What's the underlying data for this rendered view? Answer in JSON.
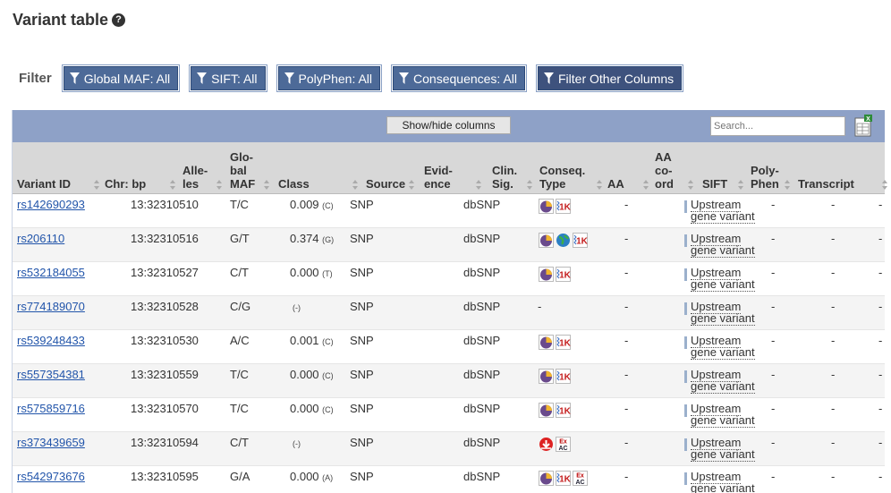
{
  "page": {
    "title": "Variant table"
  },
  "filter": {
    "label": "Filter",
    "buttons": [
      "Global MAF: All",
      "SIFT: All",
      "PolyPhen: All",
      "Consequences: All",
      "Filter Other Columns"
    ]
  },
  "toolbar": {
    "show_hide_label": "Show/hide columns",
    "search_placeholder": "Search..."
  },
  "columns": [
    [
      "Variant ID"
    ],
    [
      "Chr: bp"
    ],
    [
      "Alle-",
      "les"
    ],
    [
      "Glo-",
      "bal",
      "MAF"
    ],
    [
      "Class"
    ],
    [
      "Source"
    ],
    [
      "Evid-",
      "ence"
    ],
    [
      "Clin.",
      "Sig."
    ],
    [
      "Conseq.",
      "Type"
    ],
    [
      "AA"
    ],
    [
      "AA",
      "co-",
      "ord"
    ],
    [
      "SIFT"
    ],
    [
      "Poly-",
      "Phen"
    ],
    [
      "Transcript"
    ]
  ],
  "rows": [
    {
      "id": "rs142690293",
      "pos": "13:32310510",
      "alleles": "T/C",
      "maf": "0.009",
      "maf_allele": "(C)",
      "class": "SNP",
      "source": "dbSNP",
      "clin": "",
      "icons": [
        "pie",
        "1k"
      ],
      "aa": "-",
      "conseq": "Upstream gene variant",
      "sift": "-",
      "polyphen": "-",
      "transcript": "-"
    },
    {
      "id": "rs206110",
      "pos": "13:32310516",
      "alleles": "G/T",
      "maf": "0.374",
      "maf_allele": "(G)",
      "class": "SNP",
      "source": "dbSNP",
      "clin": "",
      "icons": [
        "pie",
        "globe",
        "1k"
      ],
      "aa": "-",
      "conseq": "Upstream gene variant",
      "sift": "-",
      "polyphen": "-",
      "transcript": "-"
    },
    {
      "id": "rs532184055",
      "pos": "13:32310527",
      "alleles": "C/T",
      "maf": "0.000",
      "maf_allele": "(T)",
      "class": "SNP",
      "source": "dbSNP",
      "clin": "",
      "icons": [
        "pie",
        "1k"
      ],
      "aa": "-",
      "conseq": "Upstream gene variant",
      "sift": "-",
      "polyphen": "-",
      "transcript": "-"
    },
    {
      "id": "rs774189070",
      "pos": "13:32310528",
      "alleles": "C/G",
      "maf": "",
      "maf_allele": "(-)",
      "class": "SNP",
      "source": "dbSNP",
      "clin": "-",
      "icons": [],
      "aa": "-",
      "conseq": "Upstream gene variant",
      "sift": "-",
      "polyphen": "-",
      "transcript": "-"
    },
    {
      "id": "rs539248433",
      "pos": "13:32310530",
      "alleles": "A/C",
      "maf": "0.001",
      "maf_allele": "(C)",
      "class": "SNP",
      "source": "dbSNP",
      "clin": "",
      "icons": [
        "pie",
        "1k"
      ],
      "aa": "-",
      "conseq": "Upstream gene variant",
      "sift": "-",
      "polyphen": "-",
      "transcript": "-"
    },
    {
      "id": "rs557354381",
      "pos": "13:32310559",
      "alleles": "T/C",
      "maf": "0.000",
      "maf_allele": "(C)",
      "class": "SNP",
      "source": "dbSNP",
      "clin": "",
      "icons": [
        "pie",
        "1k"
      ],
      "aa": "-",
      "conseq": "Upstream gene variant",
      "sift": "-",
      "polyphen": "-",
      "transcript": "-"
    },
    {
      "id": "rs575859716",
      "pos": "13:32310570",
      "alleles": "T/C",
      "maf": "0.000",
      "maf_allele": "(C)",
      "class": "SNP",
      "source": "dbSNP",
      "clin": "",
      "icons": [
        "pie",
        "1k"
      ],
      "aa": "-",
      "conseq": "Upstream gene variant",
      "sift": "-",
      "polyphen": "-",
      "transcript": "-"
    },
    {
      "id": "rs373439659",
      "pos": "13:32310594",
      "alleles": "C/T",
      "maf": "",
      "maf_allele": "(-)",
      "class": "SNP",
      "source": "dbSNP",
      "clin": "",
      "icons": [
        "arrow",
        "exac"
      ],
      "aa": "-",
      "conseq": "Upstream gene variant",
      "sift": "-",
      "polyphen": "-",
      "transcript": "-"
    },
    {
      "id": "rs542973676",
      "pos": "13:32310595",
      "alleles": "G/A",
      "maf": "0.000",
      "maf_allele": "(A)",
      "class": "SNP",
      "source": "dbSNP",
      "clin": "",
      "icons": [
        "pie",
        "1k",
        "exac"
      ],
      "aa": "-",
      "conseq": "Upstream gene variant",
      "sift": "-",
      "polyphen": "-",
      "transcript": "-"
    }
  ],
  "colors": {
    "filter_btn": "#4d6a98",
    "toolbar": "#8ea1c7",
    "header": "#d8d8d8",
    "link": "#2255aa"
  }
}
